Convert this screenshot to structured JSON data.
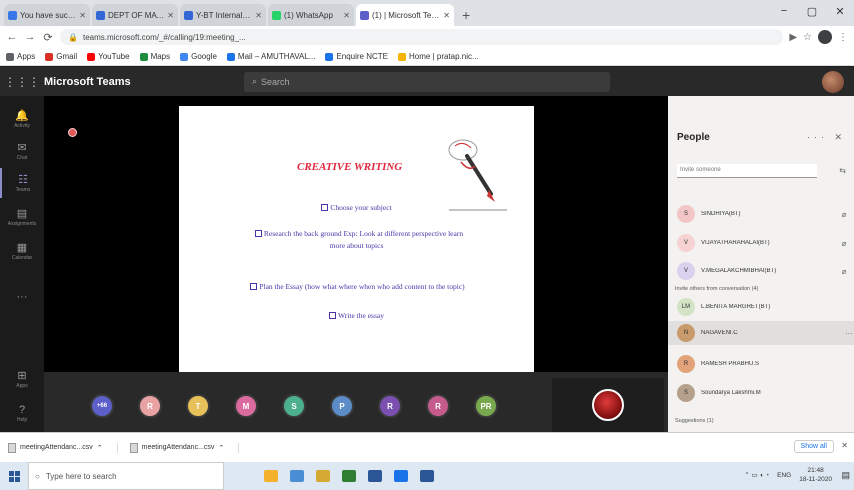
{
  "browser": {
    "tabs": [
      {
        "title": "You have successfully logged",
        "favicon": "#3b78e7"
      },
      {
        "title": "DEPT OF MATHS HOD2020",
        "favicon": "#3367d6"
      },
      {
        "title": "Y-BT Internal marks PS2020",
        "favicon": "#3367d6"
      },
      {
        "title": "(1) WhatsApp",
        "favicon": "#25d366"
      },
      {
        "title": "(1) | Microsoft Teams",
        "favicon": "#5b5fc7",
        "active": true
      }
    ],
    "new_tab": "+",
    "window_controls": [
      "−",
      "▢",
      "✕"
    ],
    "url": "teams.microsoft.com/_#/calling/19:meeting_...",
    "bookmarks": [
      {
        "label": "Apps",
        "color": "#5f6368"
      },
      {
        "label": "Gmail",
        "color": "#d93025"
      },
      {
        "label": "YouTube",
        "color": "#ff0000"
      },
      {
        "label": "Maps",
        "color": "#1e8e3e"
      },
      {
        "label": "Google",
        "color": "#4285f4"
      },
      {
        "label": "Mail – AMUTHAVAL...",
        "color": "#1a73e8"
      },
      {
        "label": "Enquire NCTE",
        "color": "#1a73e8"
      },
      {
        "label": "Home | pratap.nic...",
        "color": "#f4b400"
      }
    ]
  },
  "teams": {
    "app_name": "Microsoft Teams",
    "search_placeholder": "Search",
    "rail": [
      {
        "label": "Activity",
        "icon": "bell-icon"
      },
      {
        "label": "Chat",
        "icon": "chat-icon"
      },
      {
        "label": "Teams",
        "icon": "teams-icon",
        "active": true
      },
      {
        "label": "Assignments",
        "icon": "assignments-icon"
      },
      {
        "label": "Calendar",
        "icon": "calendar-icon"
      },
      {
        "label": "",
        "icon": "more-icon"
      },
      {
        "label": "Apps",
        "icon": "apps-icon"
      },
      {
        "label": "Help",
        "icon": "help-icon"
      }
    ]
  },
  "slide": {
    "title": "CREATIVE WRITING",
    "lines": [
      "Choose your subject",
      "Research the back ground   Exp: Look at different perspective  learn",
      "more about topics",
      "Plan the Essay  (how what where when who  add content to the topic)",
      "Write the essay"
    ]
  },
  "participants_strip": [
    {
      "initials": "+66",
      "color": "#5b5fc7"
    },
    {
      "initials": "R",
      "color": "#e8a2a2"
    },
    {
      "initials": "T",
      "color": "#e7c25a"
    },
    {
      "initials": "M",
      "color": "#d96b9e"
    },
    {
      "initials": "S",
      "color": "#4caf8e"
    },
    {
      "initials": "P",
      "color": "#5b8cc7"
    },
    {
      "initials": "R",
      "color": "#7a4fb0"
    },
    {
      "initials": "R",
      "color": "#c45b8c"
    },
    {
      "initials": "PR",
      "color": "#7aa84f"
    }
  ],
  "people": {
    "title": "People",
    "controls": "··· ✕",
    "invite_placeholder": "Invite someone",
    "presenters": [
      {
        "name": "SINDHIYA(BT)",
        "color": "#f2c6c6",
        "initials": "S"
      },
      {
        "name": "VIJAYATHARAHALAI(BT)",
        "color": "#f6d2d2",
        "initials": "V"
      },
      {
        "name": "V.MEGALAKCHMIBHAI(BT)",
        "color": "#d9d1ee",
        "initials": "V"
      }
    ],
    "others_label": "Invite others from conversation (4)",
    "others": [
      {
        "name": "L.BENITA MARGRET(BT)",
        "color": "#d3e3c5",
        "initials": "LM"
      },
      {
        "name": "NAGAVENI.C",
        "color": "#c99a6b",
        "initials": "N",
        "highlight": true
      },
      {
        "name": "RAMESH PRABHU.S",
        "color": "#e2a27a",
        "initials": "R"
      },
      {
        "name": "Soundarya Lakshmi.M",
        "color": "#b5a08c",
        "initials": "S"
      }
    ],
    "suggestions_label": "Suggestions (1)"
  },
  "downloads": {
    "items": [
      "meetingAttendanc...csv",
      "meetingAttendanc...csv"
    ],
    "show_all": "Show all"
  },
  "taskbar": {
    "search_placeholder": "Type here to search",
    "app_colors": [
      "#f3b12c",
      "#4a8fd6",
      "#d4a934",
      "#2e7d32",
      "#2b5797",
      "#1a73e8",
      "#2b5797"
    ],
    "time": "21:48",
    "date": "18-11-2020",
    "lang": "ENG"
  }
}
